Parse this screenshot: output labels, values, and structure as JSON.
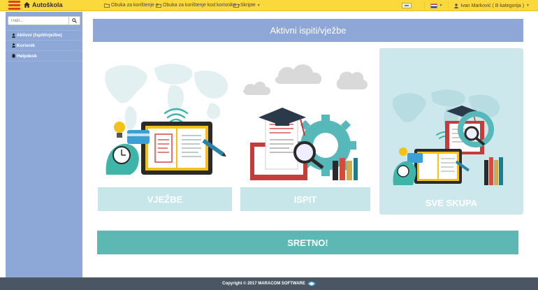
{
  "topbar": {
    "app_title": "Autoškola",
    "menus": [
      {
        "label": "Obuka za korištenje"
      },
      {
        "label": "Obuka za korištenje kod korisnika"
      },
      {
        "label": "Skripte"
      }
    ],
    "user": "Ivan Marković ( B kategorija )",
    "colors": {
      "bar": "#fbd83b",
      "hamburger": "#d9441c"
    }
  },
  "sidebar": {
    "search_placeholder": "Traži...",
    "items": [
      {
        "label": "Aktivni (Ispiti/vježbe)",
        "icon": "user-icon"
      },
      {
        "label": "Korisnik",
        "icon": "user-icon"
      },
      {
        "label": "Helpdesk",
        "icon": "helpdesk-icon"
      }
    ],
    "color": "#8da7d6"
  },
  "main": {
    "title": "Aktivni ispiti/vježbe",
    "cards": [
      {
        "label": "VJEŽBE"
      },
      {
        "label": "ISPIT"
      },
      {
        "label": "SVE SKUPA"
      }
    ],
    "banner": "SRETNO!",
    "banner_color": "#5db7b3"
  },
  "footer": {
    "text": "Copyright © 2017 MARACOM SOFTWARE"
  }
}
